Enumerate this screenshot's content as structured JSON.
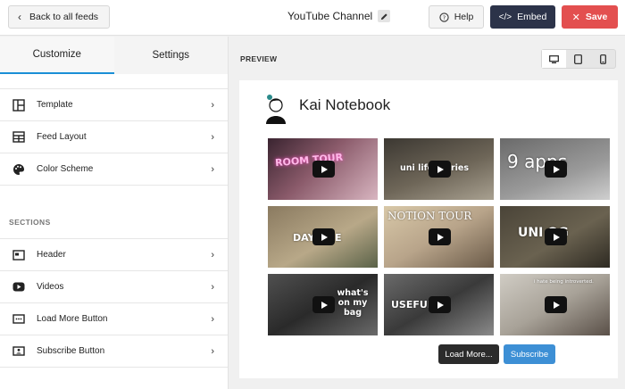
{
  "header": {
    "back_label": "Back to all feeds",
    "feed_title": "YouTube Channel",
    "help_label": "Help",
    "embed_label": "Embed",
    "save_label": "Save"
  },
  "sidebar": {
    "tabs": [
      {
        "label": "Customize",
        "active": true
      },
      {
        "label": "Settings",
        "active": false
      }
    ],
    "main_items": [
      {
        "label": "Template",
        "icon": "template-icon"
      },
      {
        "label": "Feed Layout",
        "icon": "feed-layout-icon"
      },
      {
        "label": "Color Scheme",
        "icon": "palette-icon"
      }
    ],
    "sections_label": "SECTIONS",
    "section_items": [
      {
        "label": "Header",
        "icon": "header-icon"
      },
      {
        "label": "Videos",
        "icon": "youtube-icon"
      },
      {
        "label": "Load More Button",
        "icon": "load-more-icon"
      },
      {
        "label": "Subscribe Button",
        "icon": "subscribe-icon"
      }
    ]
  },
  "preview": {
    "label": "PREVIEW",
    "devices": [
      "desktop-icon",
      "tablet-icon",
      "mobile-icon"
    ],
    "active_device": "desktop-icon",
    "channel_name": "Kai Notebook",
    "videos": [
      {
        "caption": "ROOM TOUR"
      },
      {
        "caption": "uni life diaries"
      },
      {
        "caption": "9 apps"
      },
      {
        "caption": "DAY  LIFE"
      },
      {
        "caption": "NOTION TOUR"
      },
      {
        "caption": "UNI  OG"
      },
      {
        "caption": "what's on my bag"
      },
      {
        "caption": "USEFUL"
      },
      {
        "caption": "i hate being introverted."
      }
    ],
    "load_more_label": "Load More...",
    "subscribe_label": "Subscribe"
  },
  "colors": {
    "accent_blue": "#1b8fd6",
    "embed_dark": "#2c3349",
    "save_red": "#e34f4f",
    "subscribe_blue": "#3d8fd5"
  }
}
